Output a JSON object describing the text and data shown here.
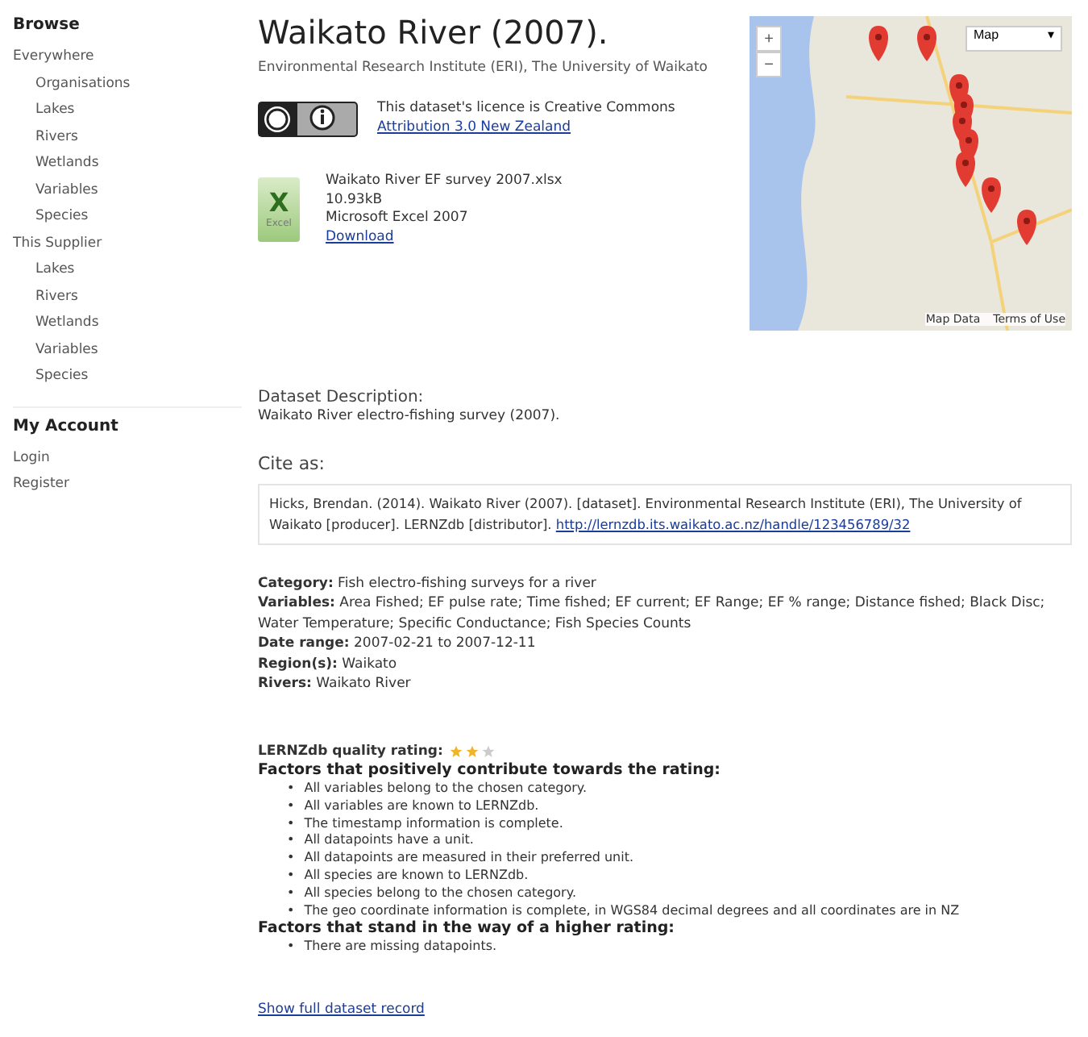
{
  "sidebar": {
    "sections": [
      {
        "title": "Browse",
        "groups": [
          {
            "label": "Everywhere",
            "items": [
              "Organisations",
              "Lakes",
              "Rivers",
              "Wetlands",
              "Variables",
              "Species"
            ]
          },
          {
            "label": "This Supplier",
            "items": [
              "Lakes",
              "Rivers",
              "Wetlands",
              "Variables",
              "Species"
            ]
          }
        ]
      },
      {
        "title": "My Account",
        "groups": [
          {
            "label": "Login"
          },
          {
            "label": "Register"
          }
        ]
      }
    ]
  },
  "dataset": {
    "title": "Waikato River (2007).",
    "publisher": "Environmental Research Institute (ERI), The University of Waikato",
    "license": {
      "text": "This dataset's licence is Creative Commons",
      "link": "Attribution 3.0 New Zealand"
    },
    "file": {
      "icon_letter": "X",
      "icon_caption": "Excel",
      "name": "Waikato River EF survey 2007.xlsx",
      "size": "10.93kB",
      "format": "Microsoft Excel 2007",
      "download": "Download"
    },
    "map": {
      "zoom_in": "+",
      "zoom_out": "−",
      "type": "Map",
      "type_caret": "▾",
      "attribution": [
        "Map Data",
        "Terms of Use"
      ]
    },
    "description_heading": "Dataset Description:",
    "description": "Waikato River electro-fishing survey (2007).",
    "cite_heading": "Cite as:",
    "citation": "Hicks, Brendan. (2014). Waikato River (2007). [dataset]. Environmental Research Institute (ERI), The University of Waikato [producer]. LERNZdb [distributor].",
    "citation_link": "http://lernzdb.its.waikato.ac.nz/handle/123456789/32",
    "fields": [
      {
        "label": "Category:",
        "value": "Fish electro-fishing surveys for a river"
      },
      {
        "label": "Variables:",
        "value": "Area Fished; EF pulse rate; Time fished; EF current; EF Range; EF % range; Distance fished; Black Disc; Water Temperature; Specific Conductance; Fish Species Counts"
      },
      {
        "label": "Date range:",
        "value": "2007-02-21 to 2007-12-11"
      },
      {
        "label": "Region(s):",
        "value": "Waikato"
      },
      {
        "label": "Rivers:",
        "value": "Waikato River"
      }
    ],
    "rating": {
      "label": "LERNZdb quality rating:",
      "stars": 2
    },
    "positive_heading": "Factors that positively contribute towards the rating:",
    "positive": [
      "All variables belong to the chosen category.",
      "All variables are known to LERNZdb.",
      "The timestamp information is complete.",
      "All datapoints have a unit.",
      "All datapoints are measured in their preferred unit.",
      "All species are known to LERNZdb.",
      "All species belong to the chosen category.",
      "The geo coordinate information is complete, in WGS84 decimal degrees and all coordinates are in NZ"
    ],
    "negative_heading": "Factors that stand in the way of a higher rating:",
    "negative": [
      "There are missing datapoints."
    ],
    "bullet": "•",
    "full_record": "Show full dataset record"
  }
}
